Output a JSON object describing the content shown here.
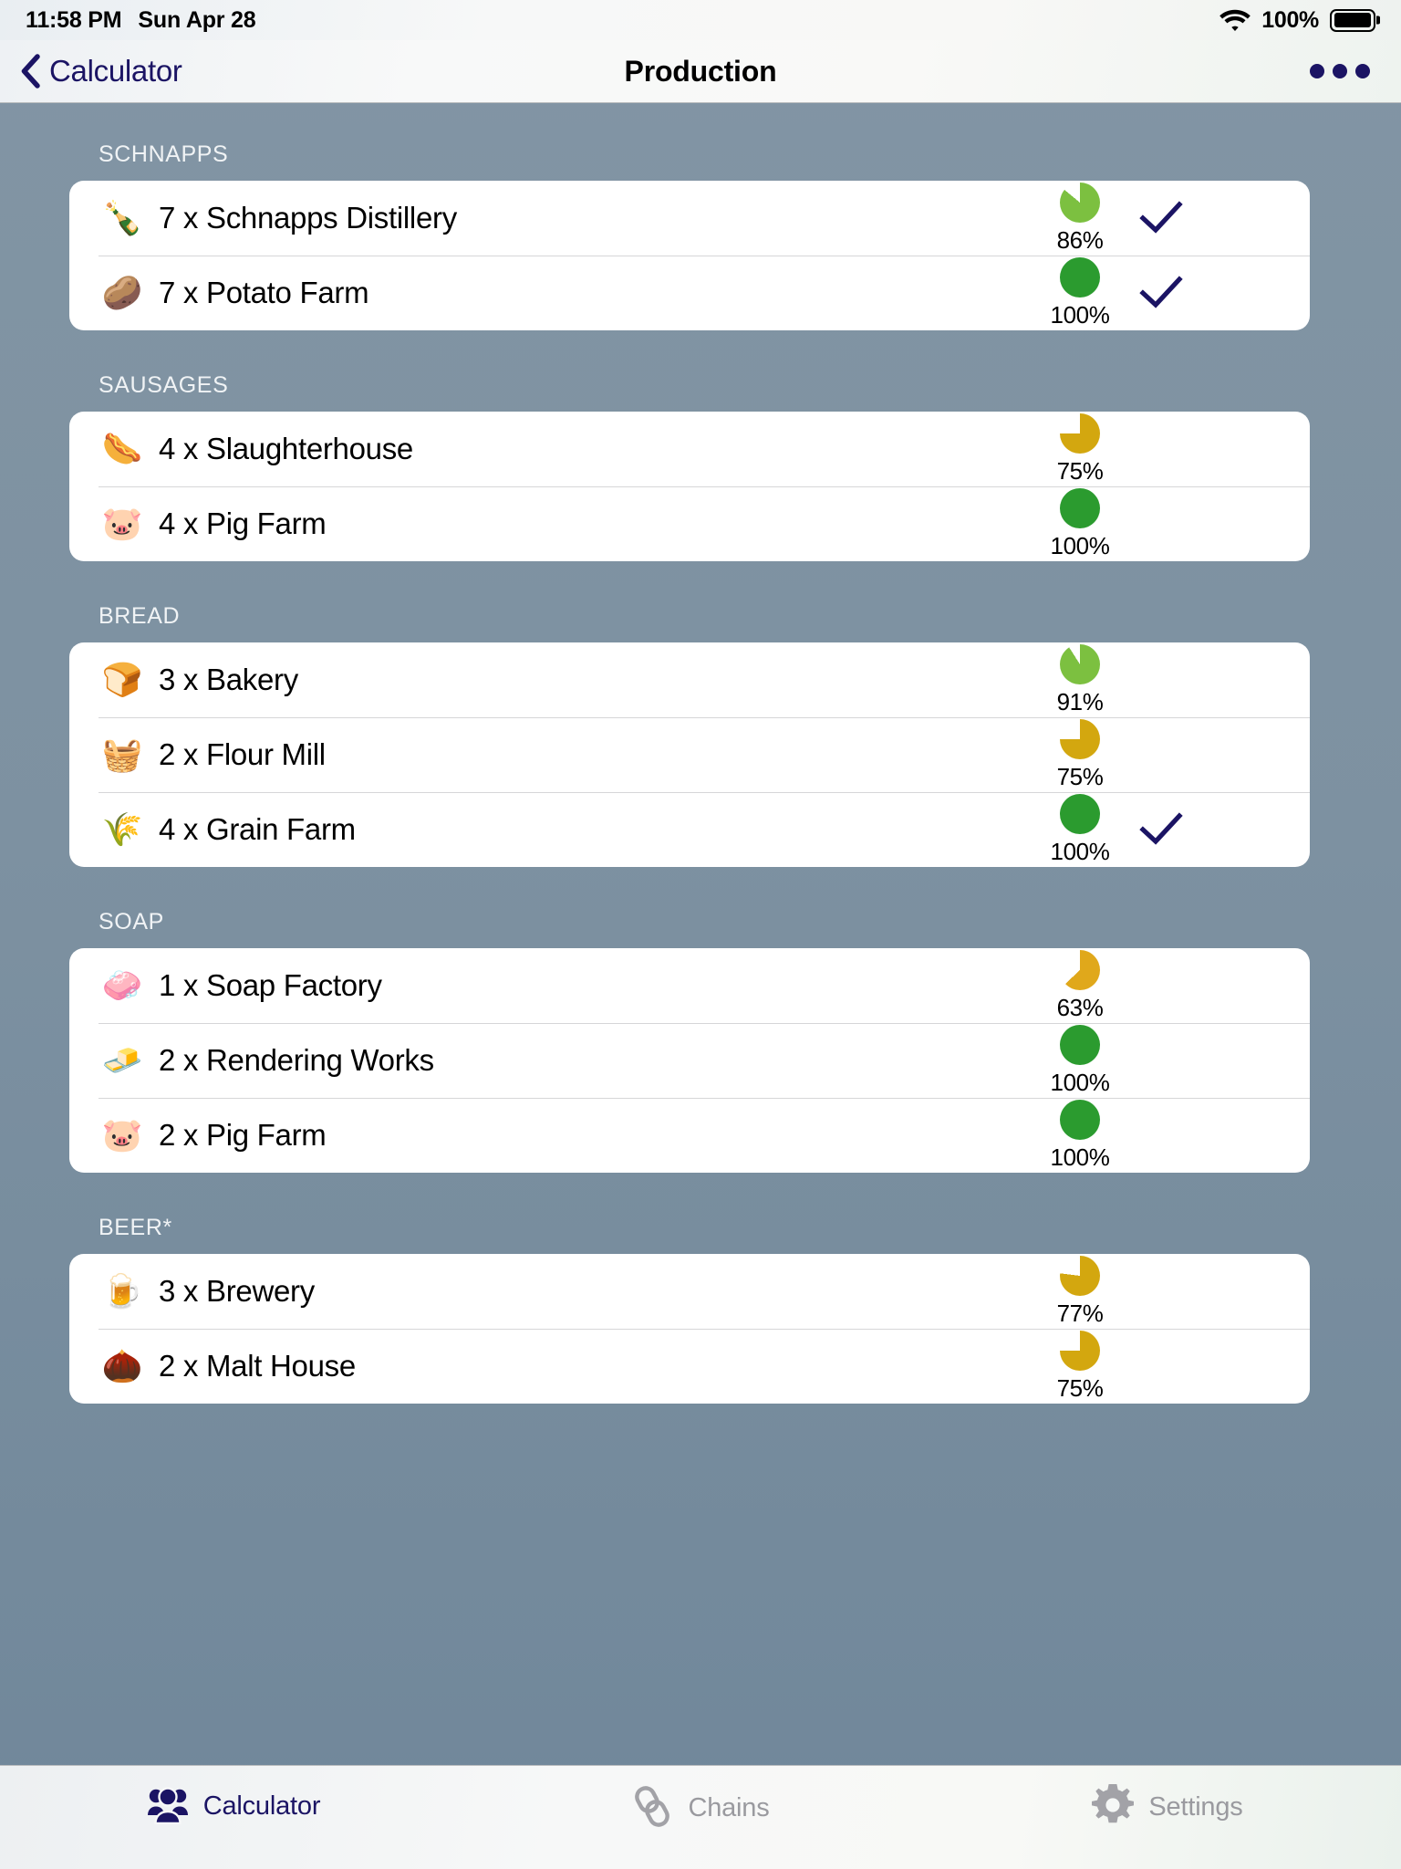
{
  "status_bar": {
    "time": "11:58 PM",
    "date": "Sun Apr 28",
    "battery_percent": "100%",
    "wifi_icon": "wifi-icon",
    "battery_icon": "battery-full-icon"
  },
  "nav_bar": {
    "back_label": "Calculator",
    "back_icon": "chevron-left-icon",
    "title": "Production",
    "more_icon": "more-horizontal-icon"
  },
  "colors": {
    "accent": "#1b1464",
    "pie_green_full": "#2b9b2f",
    "pie_green_light": "#7cc040",
    "pie_amber": "#e0a81b",
    "pie_gold": "#d3a70f",
    "background_top": "#8295a4",
    "background_bottom": "#70879a",
    "card": "#ffffff"
  },
  "sections": [
    {
      "title": "SCHNAPPS",
      "rows": [
        {
          "emoji": "🍾",
          "icon_name": "schnapps-bottle-icon",
          "label": "7 x Schnapps Distillery",
          "percent": "86%",
          "pie_value": 86,
          "pie_color": "#7cc040",
          "checked": true
        },
        {
          "emoji": "🥔",
          "icon_name": "potato-icon",
          "label": "7 x Potato Farm",
          "percent": "100%",
          "pie_value": 100,
          "pie_color": "#2b9b2f",
          "checked": true
        }
      ]
    },
    {
      "title": "SAUSAGES",
      "rows": [
        {
          "emoji": "🌭",
          "icon_name": "sausage-icon",
          "label": "4 x Slaughterhouse",
          "percent": "75%",
          "pie_value": 75,
          "pie_color": "#d3a70f",
          "checked": false
        },
        {
          "emoji": "🐷",
          "icon_name": "pig-icon",
          "label": "4 x Pig Farm",
          "percent": "100%",
          "pie_value": 100,
          "pie_color": "#2b9b2f",
          "checked": false
        }
      ]
    },
    {
      "title": "BREAD",
      "rows": [
        {
          "emoji": "🍞",
          "icon_name": "bread-icon",
          "label": "3 x Bakery",
          "percent": "91%",
          "pie_value": 91,
          "pie_color": "#7cc040",
          "checked": false
        },
        {
          "emoji": "🧺",
          "icon_name": "flour-sack-icon",
          "label": "2 x Flour Mill",
          "percent": "75%",
          "pie_value": 75,
          "pie_color": "#d3a70f",
          "checked": false
        },
        {
          "emoji": "🌾",
          "icon_name": "grain-icon",
          "label": "4 x Grain Farm",
          "percent": "100%",
          "pie_value": 100,
          "pie_color": "#2b9b2f",
          "checked": true
        }
      ]
    },
    {
      "title": "SOAP",
      "rows": [
        {
          "emoji": "🧼",
          "icon_name": "soap-bar-icon",
          "label": "1 x Soap Factory",
          "percent": "63%",
          "pie_value": 63,
          "pie_color": "#e0a81b",
          "checked": false
        },
        {
          "emoji": "🧈",
          "icon_name": "tallow-icon",
          "label": "2 x Rendering Works",
          "percent": "100%",
          "pie_value": 100,
          "pie_color": "#2b9b2f",
          "checked": false
        },
        {
          "emoji": "🐷",
          "icon_name": "pig-icon",
          "label": "2 x Pig Farm",
          "percent": "100%",
          "pie_value": 100,
          "pie_color": "#2b9b2f",
          "checked": false
        }
      ]
    },
    {
      "title": "BEER*",
      "rows": [
        {
          "emoji": "🍺",
          "icon_name": "beer-glass-icon",
          "label": "3 x Brewery",
          "percent": "77%",
          "pie_value": 77,
          "pie_color": "#d3a70f",
          "checked": false
        },
        {
          "emoji": "🌰",
          "icon_name": "malt-icon",
          "label": "2 x Malt House",
          "percent": "75%",
          "pie_value": 75,
          "pie_color": "#d3a70f",
          "checked": false
        }
      ]
    }
  ],
  "tab_bar": {
    "tabs": [
      {
        "label": "Calculator",
        "icon_name": "people-group-icon",
        "active": true
      },
      {
        "label": "Chains",
        "icon_name": "chain-links-icon",
        "active": false
      },
      {
        "label": "Settings",
        "icon_name": "gear-icon",
        "active": false
      }
    ]
  }
}
